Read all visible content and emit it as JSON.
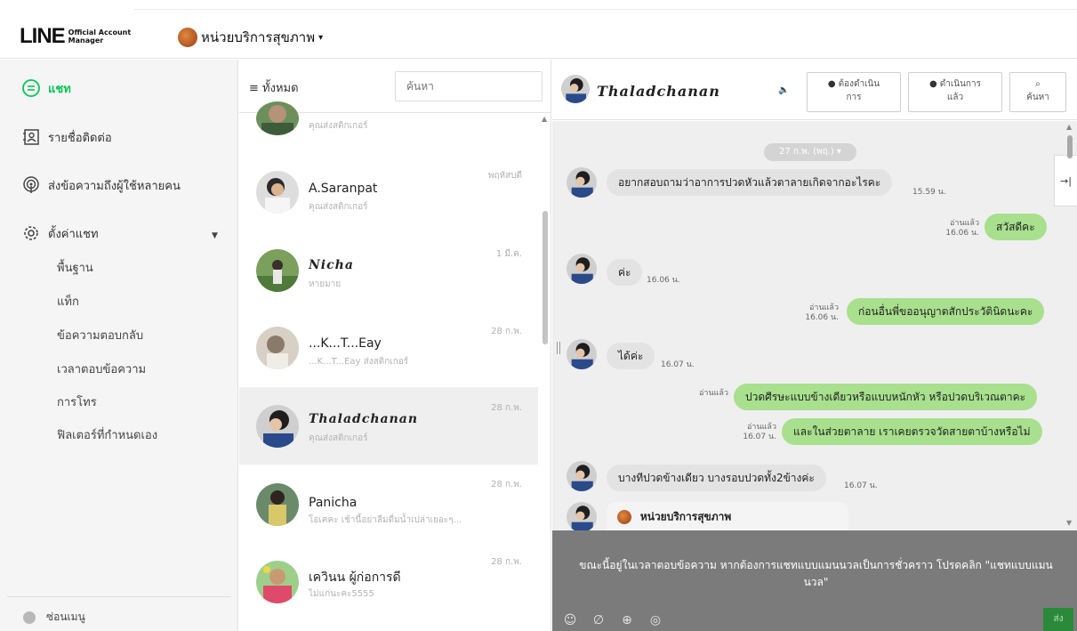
{
  "header": {
    "logo_text": "LINE",
    "logo_sub": "Official Account Manager",
    "account_name": "หน่วยบริการสุขภาพ",
    "account_caret": "▾"
  },
  "sidebar": {
    "items": [
      {
        "label": "แชท",
        "icon": "chat-bubble-icon",
        "active": true
      },
      {
        "label": "รายชื่อติดต่อ",
        "icon": "contacts-icon"
      },
      {
        "label": "ส่งข้อความถึงผู้ใช้หลายคน",
        "icon": "broadcast-icon"
      },
      {
        "label": "ตั้งค่าแชท",
        "icon": "settings-gear-icon"
      }
    ],
    "caret": "▼",
    "sub_items": [
      "พื้นฐาน",
      "แท็ก",
      "ข้อความตอบกลับ",
      "เวลาตอบข้อความ",
      "การโทร",
      "ฟิลเตอร์ที่กำหนดเอง"
    ],
    "collapse_label": "ซ่อนเมนู"
  },
  "chat_list": {
    "filter_label": "≡  ทั้งหมด",
    "search_placeholder": "ค้นหา",
    "chats": [
      {
        "name": "",
        "preview": "คุณส่งสติกเกอร์",
        "time": ""
      },
      {
        "name": "A.Saranpat",
        "preview": "คุณส่งสติกเกอร์",
        "time": "พฤหัสบดี"
      },
      {
        "name": "𝑵𝒊𝒄𝒉𝒂",
        "preview": "หายมาย",
        "time": "1 มี.ค."
      },
      {
        "name": "...K...T...Eay",
        "preview": "...K...T...Eay ส่งสติกเกอร์",
        "time": "28 ก.พ."
      },
      {
        "name": "Thaladchanan",
        "preview": "คุณส่งสติกเกอร์",
        "time": "28 ก.พ.",
        "selected": true
      },
      {
        "name": "Panicha",
        "preview": "โอเคคะ เช้านี้อย่าลืมดื่มน้ำเปล่าเยอะๆ...",
        "time": "28 ก.พ."
      },
      {
        "name": "เควินน ผู้ก่อการดี",
        "preview": "ไม่แก่นะคะ5555",
        "time": "28 ก.พ."
      }
    ]
  },
  "chat_panel": {
    "contact_name": "Thaladchanan",
    "speaker_icon": "🔈",
    "buttons": [
      {
        "icon": "●",
        "label_1": "ต้องดำเนิน",
        "label_2": "การ"
      },
      {
        "icon": "●",
        "label_1": "ดำเนินการ",
        "label_2": "แล้ว"
      },
      {
        "icon": "⌕",
        "label_1": "",
        "label_2": "ค้นหา"
      }
    ],
    "side_tab_icon": "→|",
    "date_chip": "27 ก.พ. (พฤ.) ▾",
    "read_label": "อ่านแล้ว",
    "messages": [
      {
        "dir": "in",
        "text": "อยากสอบถามว่าอาการปวดหัวแล้วตาลายเกิดจากอะไรคะ",
        "time": "15.59 น."
      },
      {
        "dir": "out",
        "text": "สวัสดีคะ",
        "time": "16.06 น."
      },
      {
        "dir": "in",
        "text": "ค่ะ",
        "time": "16.06 น."
      },
      {
        "dir": "out",
        "text": "ก่อนอื่นพี่ขออนุญาตสักประวัตินิดนะคะ",
        "time": "16.06 น."
      },
      {
        "dir": "in",
        "text": "ได้ค่ะ",
        "time": "16.07 น."
      },
      {
        "dir": "out",
        "text": "ปวดศีรษะแบบข้างเดียวหรือแบบหนักหัว หรือปวดบริเวณตาคะ",
        "time": ""
      },
      {
        "dir": "out",
        "text": "และในส่วยตาลาย เราเคยตรวจวัดสายตาบ้างหรือไม่",
        "time": "16.07 น."
      },
      {
        "dir": "in",
        "text": "บางทีปวดข้างเดียว บางรอบปวดทั้ง2ข้างค่ะ",
        "time": "16.07 น."
      },
      {
        "dir": "in",
        "text": "หน่วยบริการสุขภาพ",
        "time": ""
      }
    ],
    "autoreply_notice": "ขณะนี้อยู่ในเวลาตอบข้อความ หากต้องการแชทแบบแมนนวลเป็นการชั่วคราว โปรดคลิก \"แชทแบบแมนนวล\"",
    "send_label": "ส่ง",
    "toolbar_icons": [
      "emoji-icon",
      "attachment-icon",
      "add-icon",
      "call-icon"
    ]
  },
  "colors": {
    "brand_green": "#06c755",
    "outgoing_bubble": "#a8e08d",
    "incoming_bubble": "#e3e3e3",
    "autoreply_bg": "#7b7b7b"
  }
}
